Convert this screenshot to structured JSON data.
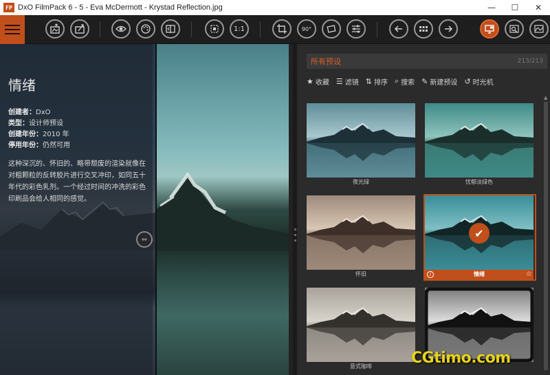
{
  "window": {
    "title": "DxO FilmPack 6 - 5 - Eva McDermott - Krystad Reflection.jpg",
    "logo_text": "FP",
    "controls": [
      "—",
      "☐",
      "✕"
    ]
  },
  "toolbar": {
    "zoom_label": "1:1",
    "rotate_label": "90°"
  },
  "preset_info": {
    "name": "情绪",
    "creator_label": "创建者：",
    "creator_value": "DxO",
    "type_label": "类型：",
    "type_value": "设计师预设",
    "created_label": "创建年份：",
    "created_value": "2010 年",
    "discontinued_label": "停用年份：",
    "discontinued_value": "仍然可用",
    "description": "这种深沉的、怀旧的、略带颓废的渲染就像在对粗颗粒的反转胶片进行交叉冲印，如同五十年代的彩色乳剂。一个经过时间的冲洗的彩色印刷品会给人相同的感觉。"
  },
  "presets_panel": {
    "header": "所有预设",
    "count": "213/213",
    "tools": [
      {
        "icon": "star-icon",
        "glyph": "★",
        "label": "收藏"
      },
      {
        "icon": "filter-icon",
        "glyph": "☰",
        "label": "滤镜"
      },
      {
        "icon": "sort-icon",
        "glyph": "⇅",
        "label": "排序"
      },
      {
        "icon": "search-icon",
        "glyph": "⌕",
        "label": "搜索"
      },
      {
        "icon": "new-preset-icon",
        "glyph": "✎",
        "label": "新建预设"
      },
      {
        "icon": "time-machine-icon",
        "glyph": "↺",
        "label": "时光机"
      }
    ],
    "thumbnails": [
      {
        "label": "夜光绿",
        "selected": false
      },
      {
        "label": "忧郁淡绿色",
        "selected": false
      },
      {
        "label": "怀旧",
        "selected": false
      },
      {
        "label": "情绪",
        "selected": true
      },
      {
        "label": "意式咖啡",
        "selected": false
      },
      {
        "label": "",
        "selected": false
      }
    ]
  },
  "watermark": "CGtimo.com",
  "colors": {
    "accent": "#c14f1b",
    "header_text": "#d8612a"
  }
}
